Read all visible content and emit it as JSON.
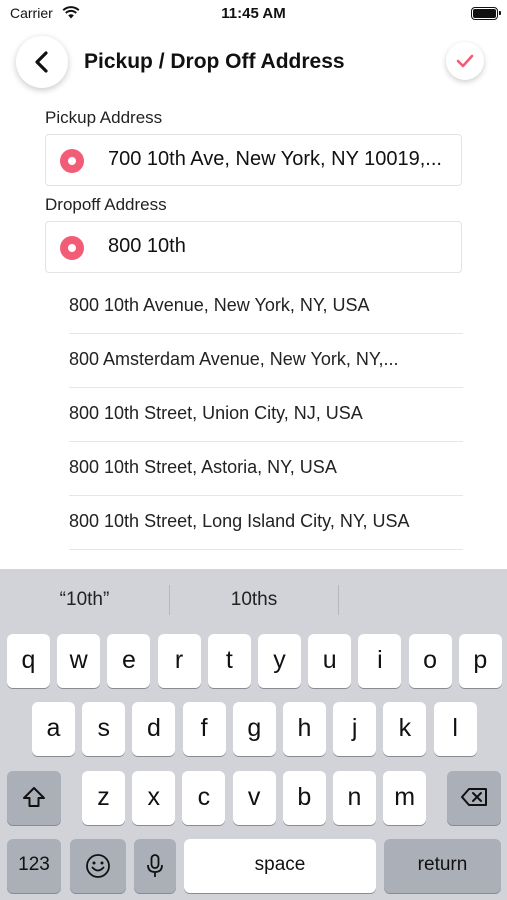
{
  "status": {
    "carrier": "Carrier",
    "time": "11:45 AM"
  },
  "header": {
    "title": "Pickup / Drop Off Address"
  },
  "pickup": {
    "label": "Pickup Address",
    "value": "700 10th Ave, New York, NY 10019,..."
  },
  "dropoff": {
    "label": "Dropoff Address",
    "value": "800 10th"
  },
  "suggestions": [
    "800 10th Avenue, New York, NY, USA",
    "800 Amsterdam Avenue, New York, NY,...",
    "800 10th Street, Union City, NJ, USA",
    "800 10th Street, Astoria, NY, USA",
    "800 10th Street, Long Island City, NY, USA"
  ],
  "keyboard": {
    "predictions": [
      "“10th”",
      "10ths",
      ""
    ],
    "row1": [
      "q",
      "w",
      "e",
      "r",
      "t",
      "y",
      "u",
      "i",
      "o",
      "p"
    ],
    "row2": [
      "a",
      "s",
      "d",
      "f",
      "g",
      "h",
      "j",
      "k",
      "l"
    ],
    "row3": [
      "z",
      "x",
      "c",
      "v",
      "b",
      "n",
      "m"
    ],
    "numbers_label": "123",
    "space_label": "space",
    "return_label": "return"
  },
  "colors": {
    "accent": "#f25c77",
    "keyboard_bg": "#d1d3d9"
  }
}
